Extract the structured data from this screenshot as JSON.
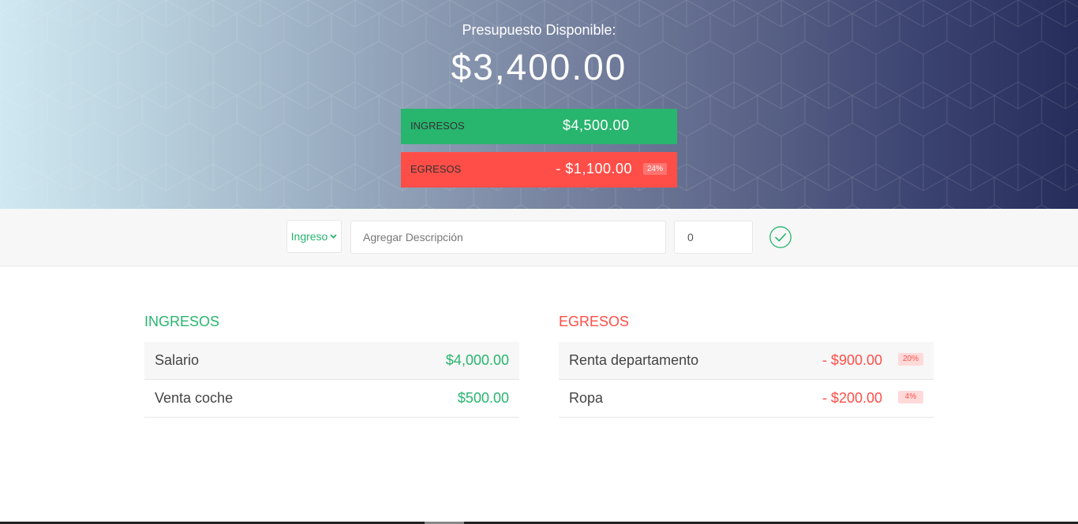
{
  "header": {
    "title": "Presupuesto Disponible:",
    "available_budget": "$3,400.00",
    "income": {
      "label": "INGRESOS",
      "value": "$4,500.00"
    },
    "expenses": {
      "label": "EGRESOS",
      "value": "- $1,100.00",
      "percentage": "24%"
    }
  },
  "add_form": {
    "type_selected": "Ingreso",
    "description_placeholder": "Agregar Descripción",
    "value": "0",
    "submit_icon": "check-circle-icon"
  },
  "income_list": {
    "title": "INGRESOS",
    "items": [
      {
        "description": "Salario",
        "value": "$4,000.00"
      },
      {
        "description": "Venta coche",
        "value": "$500.00"
      }
    ]
  },
  "expense_list": {
    "title": "EGRESOS",
    "items": [
      {
        "description": "Renta departamento",
        "value": "- $900.00",
        "percentage": "20%"
      },
      {
        "description": "Ropa",
        "value": "- $200.00",
        "percentage": "4%"
      }
    ]
  },
  "colors": {
    "income": "#28b56e",
    "expense": "#ff4e48",
    "header_gradient_start": "#cfe8f1",
    "header_gradient_end": "#272d5a"
  }
}
